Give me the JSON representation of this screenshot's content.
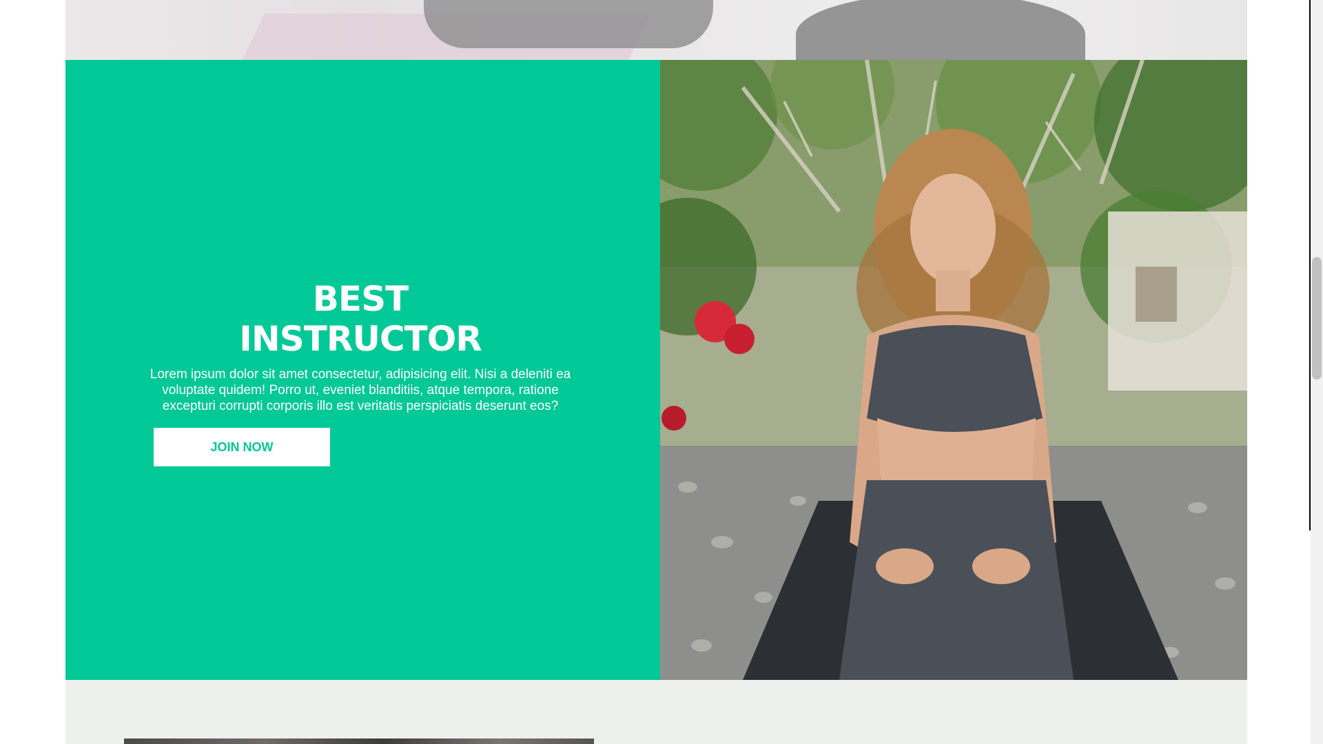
{
  "hero": {
    "title_line1": "BEST",
    "title_line2": "INSTRUCTOR",
    "description": "Lorem ipsum dolor sit amet consectetur, adipisicing elit. Nisi a deleniti ea voluptate quidem! Porro ut, eveniet blanditiis, atque tempora, ratione excepturi corrupti corporis illo est veritatis perspiciatis deserunt eos?",
    "cta_label": "JOIN NOW"
  },
  "images": {
    "top_photo": "yoga-class-photo",
    "instructor_photo": "instructor-photo",
    "bottom_photo": "gallery-photo"
  },
  "colors": {
    "accent": "#00c896",
    "section_background": "#eef0ee",
    "text_on_accent": "#ffffff"
  }
}
